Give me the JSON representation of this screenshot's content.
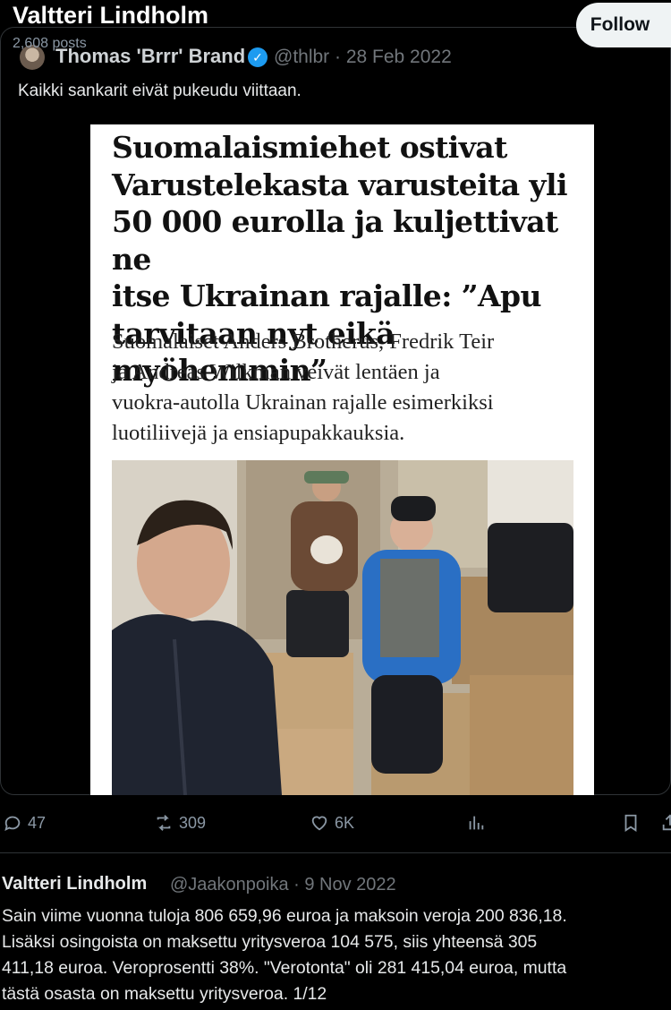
{
  "header": {
    "name": "Valtteri Lindholm",
    "posts": "2,608 posts",
    "follow_label": "Follow"
  },
  "quoted": {
    "name": "Thomas 'Brrr' Brand",
    "handle_date": "@thlbr · 28 Feb 2022",
    "text": "Kaikki sankarit eivät pukeudu viittaan.",
    "article": {
      "headline": "Suomalaismiehet ostivat\nVarustelekasta varusteita yli\n50 000 eurolla ja kuljettivat ne\nitse Ukrainan rajalle: ”Apu\ntarvitaan nyt eikä myöhemmin”",
      "subhead": "Suomalaiset Anders Brotherus, Fredrik Teir\nja Andreas Wilkman veivät lentäen ja\nvuokra-autolla Ukrainan rajalle esimerkiksi\nluotiliivejä ja ensiapupakkauksia."
    }
  },
  "actions": {
    "replies": "47",
    "reposts": "309",
    "likes": "6K"
  },
  "next_post": {
    "name": "Valtteri Lindholm",
    "handle_date": "@Jaakonpoika · 9 Nov 2022",
    "text": "Sain viime vuonna tuloja 806 659,96 euroa ja maksoin veroja 200 836,18.\nLisäksi osingoista on maksettu yritysveroa 104 575, siis yhteensä 305\n411,18 euroa. Veroprosentti 38%. \"Verotonta\" oli 281 415,04 euroa, mutta\ntästä osasta on maksettu yritysveroa. 1/12"
  },
  "colors": {
    "background": "#000000",
    "text": "#e7e9ea",
    "muted": "#71767b",
    "verified": "#1d9bf0"
  }
}
